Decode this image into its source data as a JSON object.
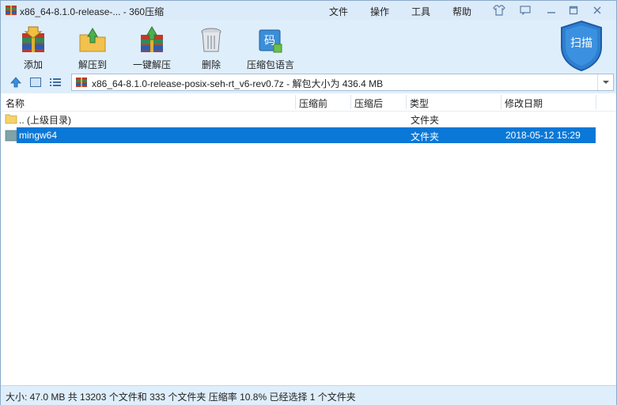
{
  "window": {
    "title": "x86_64-8.1.0-release-... - 360压缩",
    "menu": [
      "文件",
      "操作",
      "工具",
      "帮助"
    ]
  },
  "toolbar": {
    "add_label": "添加",
    "extract_to_label": "解压到",
    "one_click_extract_label": "一键解压",
    "delete_label": "删除",
    "language_pack_label": "压缩包语言",
    "language_pack_glyph": "码",
    "scan_label": "扫描"
  },
  "address": {
    "path": "x86_64-8.1.0-release-posix-seh-rt_v6-rev0.7z - 解包大小为 436.4 MB"
  },
  "columns": [
    "名称",
    "压缩前",
    "压缩后",
    "类型",
    "修改日期"
  ],
  "rows": [
    {
      "name": ".. (上级目录)",
      "before": "",
      "after": "",
      "type": "文件夹",
      "modified": "",
      "selected": false
    },
    {
      "name": "mingw64",
      "before": "",
      "after": "",
      "type": "文件夹",
      "modified": "2018-05-12 15:29",
      "selected": true
    }
  ],
  "status": {
    "text": "大小: 47.0 MB 共 13203 个文件和 333 个文件夹 压缩率 10.8% 已经选择 1 个文件夹"
  },
  "colors": {
    "selection": "#0a78d7",
    "chrome": "#dfeefb",
    "shield": "#2f7fd0"
  }
}
